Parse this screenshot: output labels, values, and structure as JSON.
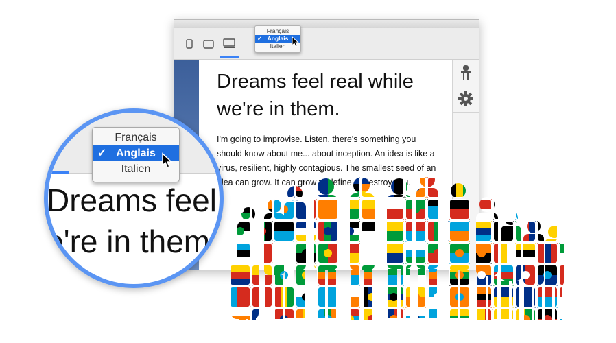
{
  "toolbar": {
    "device_buttons": [
      {
        "name": "phone",
        "icon": "phone-icon"
      },
      {
        "name": "tablet",
        "icon": "tablet-icon"
      },
      {
        "name": "desktop",
        "icon": "desktop-icon",
        "active": true
      }
    ]
  },
  "language_menu": {
    "options": [
      "Français",
      "Anglais",
      "Italien"
    ],
    "selected": "Anglais",
    "check": "✓"
  },
  "content": {
    "heading": "Dreams feel real while we're in them.",
    "paragraph": "I'm going to improvise. Listen, there's something you should know about me... about inception. An idea is like a virus, resilient, highly contagious. The smallest seed of an idea can grow. It can grow to define or destroy you."
  },
  "magnifier": {
    "line1": "Dreams feel",
    "line2": "we're in them."
  },
  "sidebar": {
    "buttons": [
      {
        "name": "pin",
        "icon": "pin-icon"
      },
      {
        "name": "settings",
        "icon": "gear-icon"
      }
    ]
  },
  "colors": {
    "accent": "#5b95f3",
    "selection": "#1f6fe0",
    "flags": [
      "#d52b1e",
      "#002f87",
      "#ffd100",
      "#009b3a",
      "#ffffff",
      "#00a3dd",
      "#ff7e00",
      "#000000"
    ]
  }
}
